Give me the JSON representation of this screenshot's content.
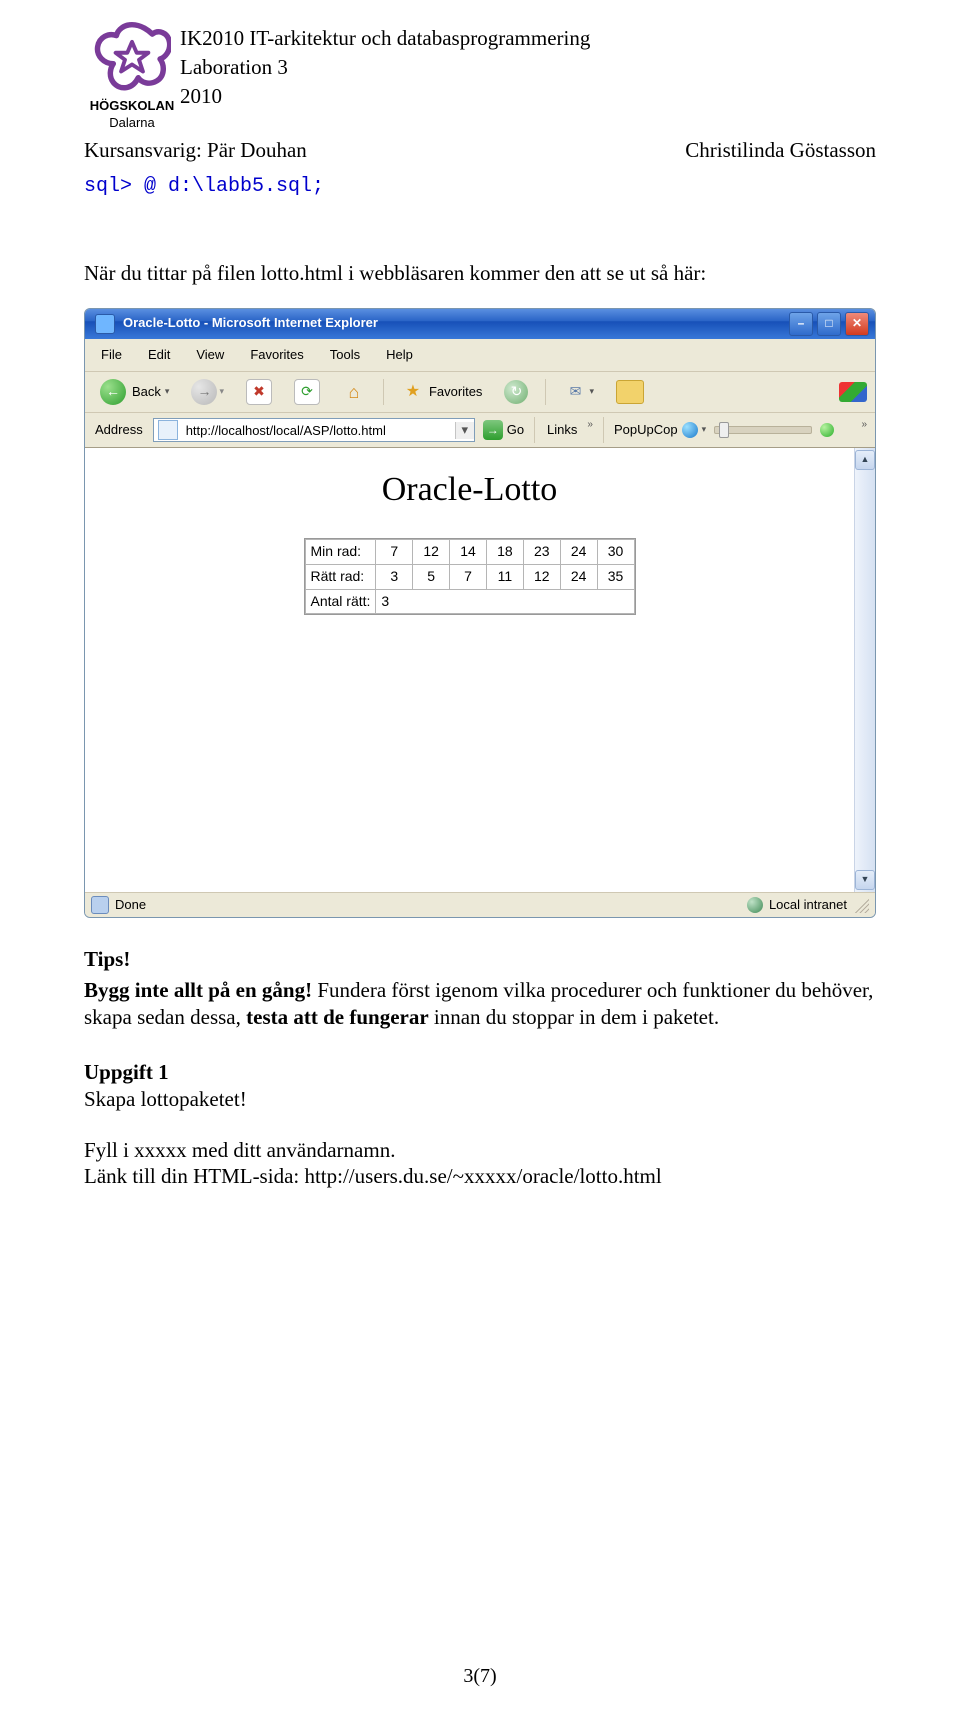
{
  "header": {
    "course_line": "IK2010 IT-arkitektur och databasprogrammering",
    "lab_line": "Laboration 3",
    "year_line": "2010",
    "logo_top": "HÖGSKOLAN",
    "logo_bottom": "Dalarna",
    "left_name": "Kursansvarig: Pär Douhan",
    "right_name": "Christilinda Göstasson"
  },
  "sql_line": "sql> @ d:\\labb5.sql;",
  "intro_line": "När du tittar på filen lotto.html i webbläsaren kommer den att se ut så här:",
  "browser": {
    "title": "Oracle-Lotto - Microsoft Internet Explorer",
    "menu": {
      "file": "File",
      "edit": "Edit",
      "view": "View",
      "fav": "Favorites",
      "tools": "Tools",
      "help": "Help"
    },
    "back_label": "Back",
    "favorites_label": "Favorites",
    "addr_label": "Address",
    "url_value": "http://localhost/local/ASP/lotto.html",
    "go_label": "Go",
    "links_label": "Links",
    "popupcop_label": "PopUpCop",
    "status_left": "Done",
    "status_right": "Local intranet"
  },
  "lotto": {
    "page_title": "Oracle-Lotto",
    "row1_label": "Min rad:",
    "row1": [
      "7",
      "12",
      "14",
      "18",
      "23",
      "24",
      "30"
    ],
    "row2_label": "Rätt rad:",
    "row2": [
      "3",
      "5",
      "7",
      "11",
      "12",
      "24",
      "35"
    ],
    "antal_label": "Antal rätt:",
    "antal_value": "3"
  },
  "body": {
    "tips": "Tips!",
    "bygg_bold": "Bygg inte allt på en gång!",
    "tips_rest": " Fundera först igenom vilka procedurer och funktioner du behöver, skapa sedan dessa, ",
    "testa_bold": "testa att de fungerar",
    "tips_rest2": " innan du stoppar in dem i paketet.",
    "uppgift_title": "Uppgift 1",
    "uppgift_line": "Skapa lottopaketet!",
    "fill_line": "Fyll i xxxxx med ditt användarnamn.",
    "link_line": "Länk till din HTML-sida: http://users.du.se/~xxxxx/oracle/lotto.html"
  },
  "page_number": "3(7)"
}
